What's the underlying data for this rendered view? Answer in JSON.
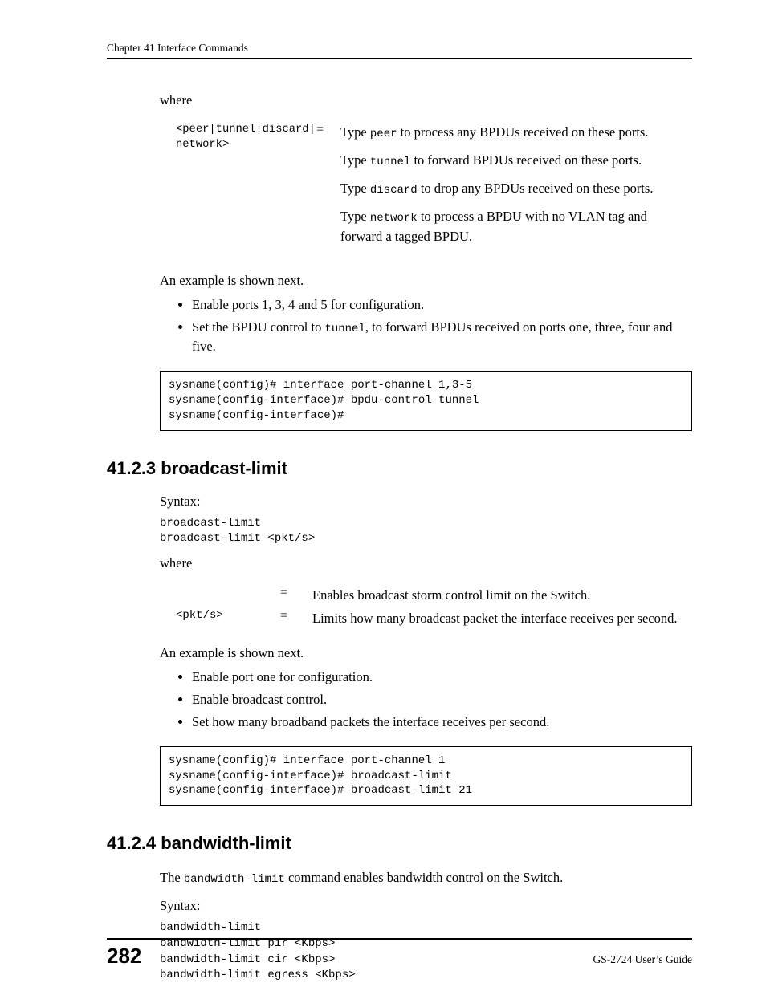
{
  "header": "Chapter 41 Interface Commands",
  "where": "where",
  "param1_code": "<peer|tunnel|discard|\nnetwork>",
  "eq": "=",
  "p1_type": "Type ",
  "p1_peer_c": "peer",
  "p1_peer_r": " to process any BPDUs received on these ports.",
  "p1_tun_c": "tunnel",
  "p1_tun_r": " to forward BPDUs received on these ports.",
  "p1_dis_c": "discard",
  "p1_dis_r": " to drop any BPDUs received on these ports.",
  "p1_net_c": "network",
  "p1_net_r": " to process a BPDU with no VLAN tag and forward a tagged BPDU.",
  "ex_intro": "An example is shown next.",
  "ex_li1": "Enable ports 1, 3, 4 and 5 for configuration.",
  "ex_li2a": "Set the BPDU control to ",
  "ex_li2code": "tunnel",
  "ex_li2b": ", to forward BPDUs received on ports one, three, four and five.",
  "code1": "sysname(config)# interface port-channel 1,3-5\nsysname(config-interface)# bpdu-control tunnel\nsysname(config-interface)#",
  "h_4123": "41.2.3  broadcast-limit",
  "syntax": "Syntax:",
  "syntax_code1": "broadcast-limit\nbroadcast-limit <pkt/s>",
  "t1r1d": "Enables broadcast storm control limit on the Switch.",
  "t1r2p": "<pkt/s>",
  "t1r2d": "Limits how many broadcast packet the interface receives per second.",
  "ex2_li1": "Enable port one for configuration.",
  "ex2_li2": "Enable broadcast control.",
  "ex2_li3": "Set how many broadband packets the interface receives per second.",
  "code2": "sysname(config)# interface port-channel 1\nsysname(config-interface)# broadcast-limit\nsysname(config-interface)# broadcast-limit 21",
  "h_4124": "41.2.4  bandwidth-limit",
  "bw_p1a": "The ",
  "bw_p1code": "bandwidth-limit",
  "bw_p1b": " command enables bandwidth control on the Switch.",
  "syntax_code2": "bandwidth-limit\nbandwidth-limit pir <Kbps>\nbandwidth-limit cir <Kbps>\nbandwidth-limit egress <Kbps>",
  "page_num": "282",
  "guide": "GS-2724 User’s Guide"
}
